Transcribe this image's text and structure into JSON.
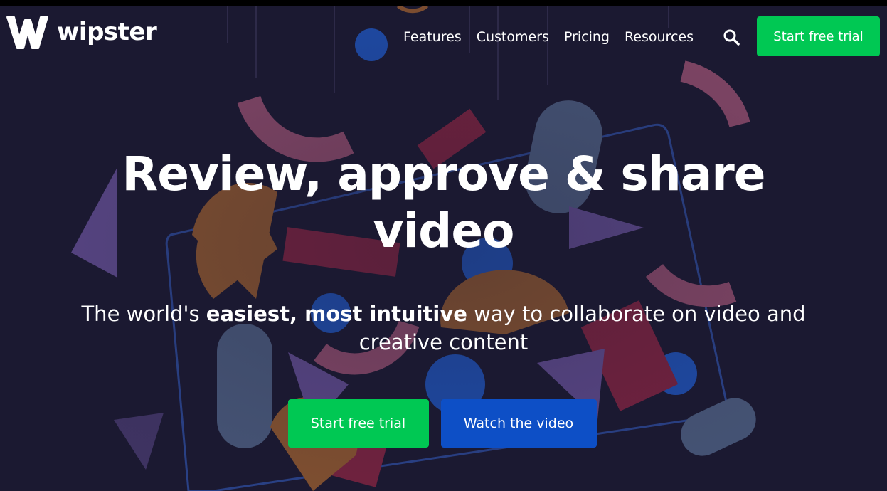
{
  "brand": {
    "name": "wipster",
    "logo_icon": "wipster-w-logo"
  },
  "nav": {
    "items": [
      {
        "label": "Features"
      },
      {
        "label": "Customers"
      },
      {
        "label": "Pricing"
      },
      {
        "label": "Resources"
      }
    ],
    "search_icon": "search-icon",
    "cta_label": "Start free trial"
  },
  "hero": {
    "title_line1": "Review, approve & share",
    "title_line2": "video",
    "subtitle_lead": "The world's ",
    "subtitle_bold": "easiest, most intuitive",
    "subtitle_rest": " way to collaborate on video and creative content",
    "primary_cta": "Start free trial",
    "secondary_cta": "Watch the video"
  },
  "colors": {
    "background": "#1b1931",
    "accent_green": "#00c853",
    "accent_blue": "#0d4fc6",
    "shape_pink": "#8a4a6a",
    "shape_red": "#7a2340",
    "shape_orange": "#8a5530",
    "shape_purple": "#5e4a8c",
    "shape_blue": "#1f4fb0",
    "shape_grey": "#4a5a7c"
  }
}
